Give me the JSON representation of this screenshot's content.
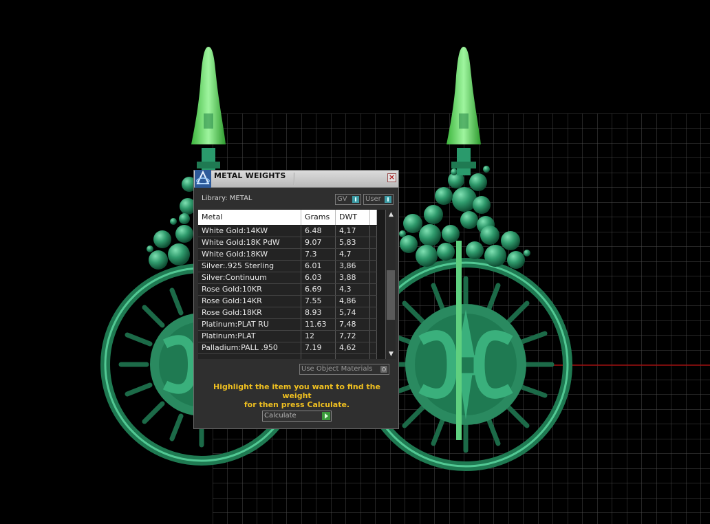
{
  "dialog": {
    "title": "METAL WEIGHTS",
    "close_glyph": "×",
    "library_label": "Library: METAL",
    "gv_label": "GV",
    "user_label": "User",
    "columns": [
      "Metal",
      "Grams",
      "DWT"
    ],
    "rows": [
      {
        "metal": "White Gold:14KW",
        "grams": "6.48",
        "dwt": "4,17"
      },
      {
        "metal": "White Gold:18K PdW",
        "grams": "9.07",
        "dwt": "5,83"
      },
      {
        "metal": "White Gold:18KW",
        "grams": "7.3",
        "dwt": "4,7"
      },
      {
        "metal": "Silver:.925 Sterling",
        "grams": "6.01",
        "dwt": "3,86"
      },
      {
        "metal": "Silver:Continuum",
        "grams": "6.03",
        "dwt": "3,88"
      },
      {
        "metal": "Rose Gold:10KR",
        "grams": "6.69",
        "dwt": "4,3"
      },
      {
        "metal": "Rose Gold:14KR",
        "grams": "7.55",
        "dwt": "4,86"
      },
      {
        "metal": "Rose Gold:18KR",
        "grams": "8.93",
        "dwt": "5,74"
      },
      {
        "metal": "Platinum:PLAT RU",
        "grams": "11.63",
        "dwt": "7,48"
      },
      {
        "metal": "Platinum:PLAT",
        "grams": "12",
        "dwt": "7,72"
      },
      {
        "metal": "Palladium:PALL .950",
        "grams": "7.19",
        "dwt": "4,62"
      }
    ],
    "use_object_materials_label": "Use Object Materials",
    "hint_line1": "Highlight the item you want to find the weight",
    "hint_line2": "for then press Calculate.",
    "calculate_label": "Calculate",
    "scroll_up_glyph": "▲",
    "scroll_down_glyph": "▼"
  },
  "icons": {
    "app_logo": "matrix-logo-icon",
    "close": "close-icon",
    "check_gv": "check-icon",
    "check_user": "check-icon",
    "calculate_go": "play-icon"
  },
  "colors": {
    "model_green": "#2f9a6c",
    "grid_line": "#4a4a4a",
    "axis_red": "#a01010",
    "hint_text": "#f0c020",
    "toggle_accent": "#3c9aa4"
  }
}
